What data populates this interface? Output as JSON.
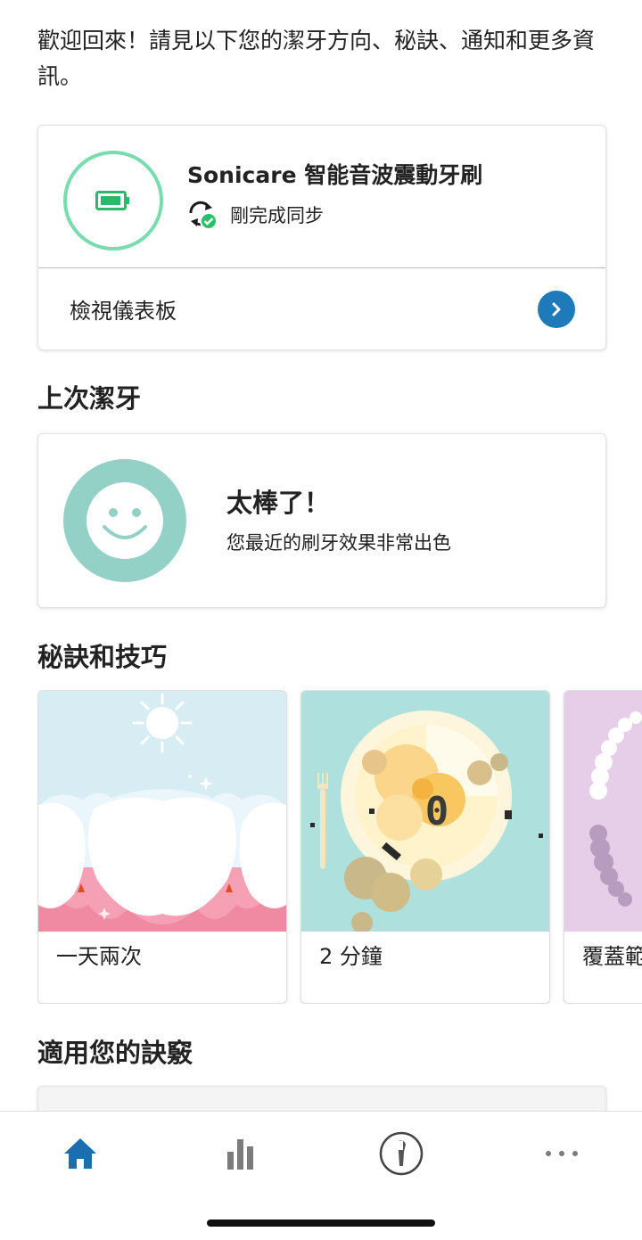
{
  "greeting": "歡迎回來！請見以下您的潔牙方向、秘訣、通知和更多資訊。",
  "device": {
    "name": "Sonicare 智能音波震動牙刷",
    "sync_status": "剛完成同步",
    "dashboard_link": "檢視儀表板",
    "battery_icon": "battery-icon",
    "sync_icon": "sync-icon"
  },
  "last_brush": {
    "heading": "上次潔牙",
    "title": "太棒了！",
    "subtitle": "您最近的刷牙效果非常出色",
    "icon": "smiley-icon"
  },
  "tips": {
    "heading": "秘訣和技巧",
    "items": [
      {
        "label": "一天兩次"
      },
      {
        "label": "2 分鐘"
      },
      {
        "label": "覆蓋範"
      }
    ]
  },
  "for_you": {
    "heading": "適用您的訣竅"
  },
  "tabbar": {
    "items": [
      {
        "icon": "home-icon",
        "active": true
      },
      {
        "icon": "stats-icon",
        "active": false
      },
      {
        "icon": "brush-head-icon",
        "active": false
      },
      {
        "icon": "more-icon",
        "active": false
      }
    ]
  },
  "colors": {
    "accent": "#1e7ab8",
    "battery_green": "#2bb86b",
    "ring_green": "#79dcae",
    "smiley_teal": "#93d0c6"
  }
}
